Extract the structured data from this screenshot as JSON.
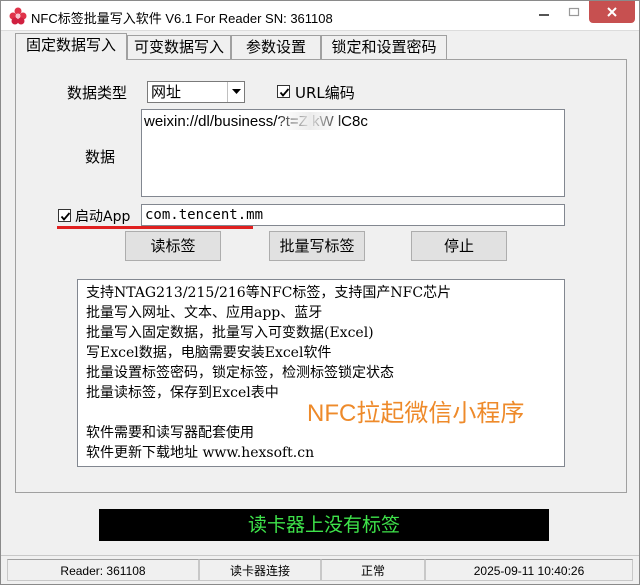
{
  "window": {
    "title": "NFC标签批量写入软件 V6.1 For Reader  SN:  361108"
  },
  "tabs": [
    {
      "label": "固定数据写入",
      "active": true
    },
    {
      "label": "可变数据写入",
      "active": false
    },
    {
      "label": "参数设置",
      "active": false
    },
    {
      "label": "锁定和设置密码",
      "active": false
    }
  ],
  "form": {
    "data_type_label": "数据类型",
    "data_type_value": "网址",
    "url_encode_label": "URL编码",
    "url_encode_checked": true,
    "data_label": "数据",
    "data_value": "weixin://dl/business/?t=Z         kW   lC8c",
    "launch_app_label": "启动App",
    "launch_app_checked": true,
    "launch_app_value": "com.tencent.mm"
  },
  "buttons": {
    "read": "读标签",
    "batch_write": "批量写标签",
    "stop": "停止"
  },
  "info": {
    "lines": [
      "支持NTAG213/215/216等NFC标签，支持国产NFC芯片",
      "批量写入网址、文本、应用app、蓝牙",
      "批量写入固定数据，批量写入可变数据(Excel)",
      "写Excel数据，电脑需要安装Excel软件",
      "批量设置标签密码，锁定标签，检测标签锁定状态",
      "批量读标签，保存到Excel表中",
      "",
      "软件需要和读写器配套使用",
      "软件更新下载地址 www.hexsoft.cn"
    ],
    "overlay": "NFC拉起微信小程序"
  },
  "status_banner": "读卡器上没有标签",
  "statusbar": {
    "reader": "Reader: 361108",
    "connection": "读卡器连接",
    "state": "正常",
    "datetime": "2025-09-11 10:40:26"
  },
  "colors": {
    "banner_bg": "#000000",
    "banner_text": "#3ee34a",
    "overlay_text": "#ee8a2a",
    "close_button": "#c75050",
    "annotation_underline": "#e02020"
  }
}
